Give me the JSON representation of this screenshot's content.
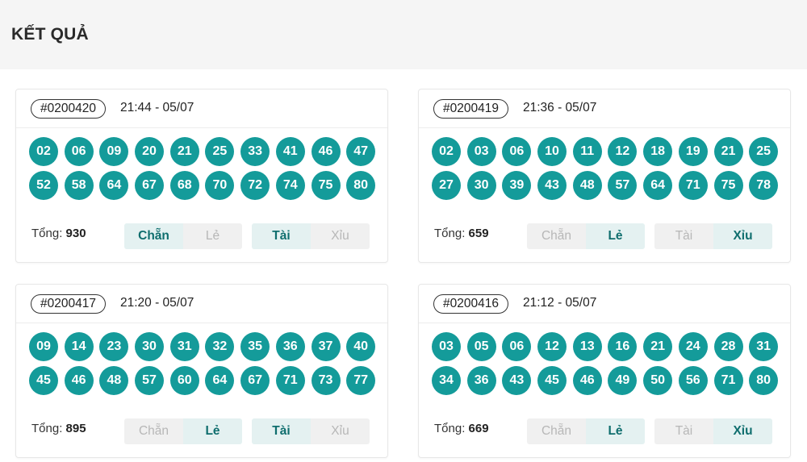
{
  "page": {
    "title": "KẾT QUẢ"
  },
  "total_label": "Tổng:",
  "colors": {
    "ball": "#149b9a",
    "active_bg": "#e4f1f1",
    "active_text": "#0f6e6e",
    "inactive_text": "#b7b7b7"
  },
  "draws": [
    {
      "id": "#0200420",
      "time": "21:44 - 05/07",
      "numbers": [
        "02",
        "06",
        "09",
        "20",
        "21",
        "25",
        "33",
        "41",
        "46",
        "47",
        "52",
        "58",
        "64",
        "67",
        "68",
        "70",
        "72",
        "74",
        "75",
        "80"
      ],
      "total": "930",
      "parity": {
        "even": "Chẵn",
        "odd": "Lẻ",
        "selected": "even"
      },
      "size": {
        "big": "Tài",
        "small": "Xỉu",
        "selected": "big"
      }
    },
    {
      "id": "#0200419",
      "time": "21:36 - 05/07",
      "numbers": [
        "02",
        "03",
        "06",
        "10",
        "11",
        "12",
        "18",
        "19",
        "21",
        "25",
        "27",
        "30",
        "39",
        "43",
        "48",
        "57",
        "64",
        "71",
        "75",
        "78"
      ],
      "total": "659",
      "parity": {
        "even": "Chẵn",
        "odd": "Lẻ",
        "selected": "odd"
      },
      "size": {
        "big": "Tài",
        "small": "Xỉu",
        "selected": "small"
      }
    },
    {
      "id": "#0200417",
      "time": "21:20 - 05/07",
      "numbers": [
        "09",
        "14",
        "23",
        "30",
        "31",
        "32",
        "35",
        "36",
        "37",
        "40",
        "45",
        "46",
        "48",
        "57",
        "60",
        "64",
        "67",
        "71",
        "73",
        "77"
      ],
      "total": "895",
      "parity": {
        "even": "Chẵn",
        "odd": "Lẻ",
        "selected": "odd"
      },
      "size": {
        "big": "Tài",
        "small": "Xỉu",
        "selected": "big"
      }
    },
    {
      "id": "#0200416",
      "time": "21:12 - 05/07",
      "numbers": [
        "03",
        "05",
        "06",
        "12",
        "13",
        "16",
        "21",
        "24",
        "28",
        "31",
        "34",
        "36",
        "43",
        "45",
        "46",
        "49",
        "50",
        "56",
        "71",
        "80"
      ],
      "total": "669",
      "parity": {
        "even": "Chẵn",
        "odd": "Lẻ",
        "selected": "odd"
      },
      "size": {
        "big": "Tài",
        "small": "Xỉu",
        "selected": "small"
      }
    }
  ]
}
